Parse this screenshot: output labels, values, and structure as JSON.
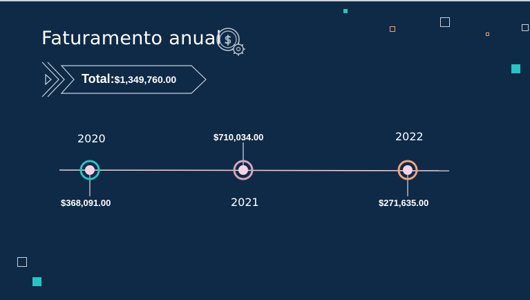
{
  "slide": {
    "title": "Faturamento anual",
    "total_label": "Total",
    "total_colon": ":",
    "total_value": "$1,349,760.00"
  },
  "timeline": [
    {
      "year": "2020",
      "amount": "$368,091.00",
      "color": "#27c4c4"
    },
    {
      "year": "2021",
      "amount": "$710,034.00",
      "color": "#d9a3b9"
    },
    {
      "year": "2022",
      "amount": "$271,635.00",
      "color": "#f2a37a"
    }
  ],
  "colors": {
    "background": "#0f2a47",
    "line": "#e8d6e0",
    "dot_fill": "#f7d4e3",
    "teal": "#27c4c4",
    "orange": "#f2a37a",
    "outline": "#c9d3dd"
  },
  "icons": [
    "money-gear-icon",
    "double-chevron-icon"
  ]
}
